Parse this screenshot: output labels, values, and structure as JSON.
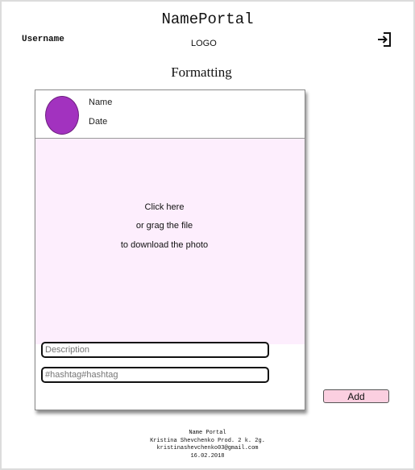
{
  "header": {
    "site_title": "NamePortal",
    "username": "Username",
    "logo": "LOGO",
    "logout_icon": "logout-icon"
  },
  "page": {
    "heading": "Formatting"
  },
  "card": {
    "name_label": "Name",
    "date_label": "Date",
    "avatar_color": "#a232bf",
    "drop_zone": {
      "line1": "Click here",
      "line2": "or grag the file",
      "line3": "to download the photo",
      "background": "#fdeefd"
    },
    "description": {
      "placeholder": "Description",
      "value": ""
    },
    "hashtags": {
      "placeholder": "#hashtag#hashtag",
      "value": ""
    }
  },
  "actions": {
    "add_label": "Add",
    "add_color": "#fbcfe0"
  },
  "footer": {
    "line1": "Name Portal",
    "line2": "Kristina Shevchenko Prod.  2 k. 2g.",
    "line3": "kristinashevchenko03@gmail.com",
    "line4": "16.02.2018"
  }
}
